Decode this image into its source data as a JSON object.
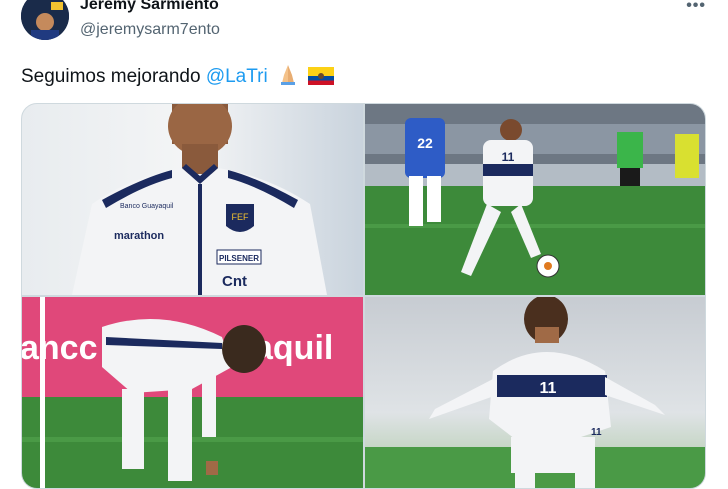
{
  "tweet": {
    "author_name": "Jeremy Sarmiento",
    "author_handle": "@jeremysarm7ento",
    "text_before": "Seguimos mejorando ",
    "mention": "@LaTri",
    "emojis": [
      "folded-hands-emoji",
      "ecuador-flag-emoji"
    ]
  },
  "media": {
    "photo1": {
      "jersey_text": "marathon",
      "sponsor_text": "PILSENER",
      "badge_text": "Cnt",
      "bank_text": "Banco Guayaquil"
    },
    "photo2": {
      "player1_number": "22",
      "player2_number": "11"
    },
    "photo3": {
      "banner_text": "ancc",
      "banner_text2": "aquil"
    },
    "photo4": {
      "player_number": "11",
      "shorts_number": "11"
    }
  },
  "colors": {
    "link": "#1d9bf0",
    "handle": "#536471",
    "kit_navy": "#1b2a5e",
    "pitch_green": "#3d8a3a",
    "banner_pink": "#e0487a"
  }
}
